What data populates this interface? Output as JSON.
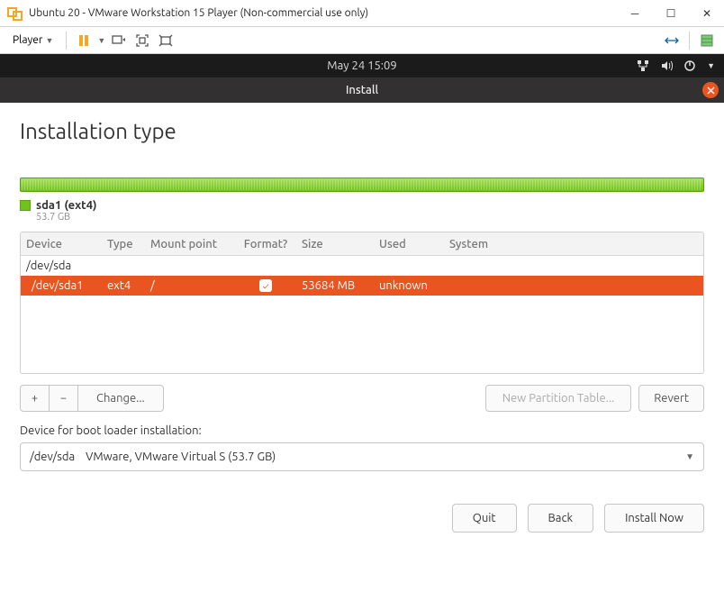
{
  "vmware": {
    "title": "Ubuntu 20 - VMware Workstation 15 Player (Non-commercial use only)",
    "player_label": "Player"
  },
  "ubuntu": {
    "datetime": "May 24  15:09"
  },
  "installer": {
    "header": "Install",
    "title": "Installation type",
    "partition": {
      "label": "sda1 (ext4)",
      "size": "53.7 GB"
    },
    "columns": {
      "device": "Device",
      "type": "Type",
      "mount": "Mount point",
      "format": "Format?",
      "size": "Size",
      "used": "Used",
      "system": "System"
    },
    "rows": {
      "parent": {
        "device": "/dev/sda"
      },
      "child": {
        "device": "  /dev/sda1",
        "type": "ext4",
        "mount": "/",
        "format": true,
        "size": "53684 MB",
        "used": "unknown",
        "system": ""
      }
    },
    "buttons": {
      "plus": "+",
      "minus": "−",
      "change": "Change...",
      "new_table": "New Partition Table...",
      "revert": "Revert"
    },
    "boot_label": "Device for boot loader installation:",
    "boot_value": "/dev/sda    VMware, VMware Virtual S (53.7 GB)",
    "nav": {
      "quit": "Quit",
      "back": "Back",
      "install": "Install Now"
    }
  }
}
